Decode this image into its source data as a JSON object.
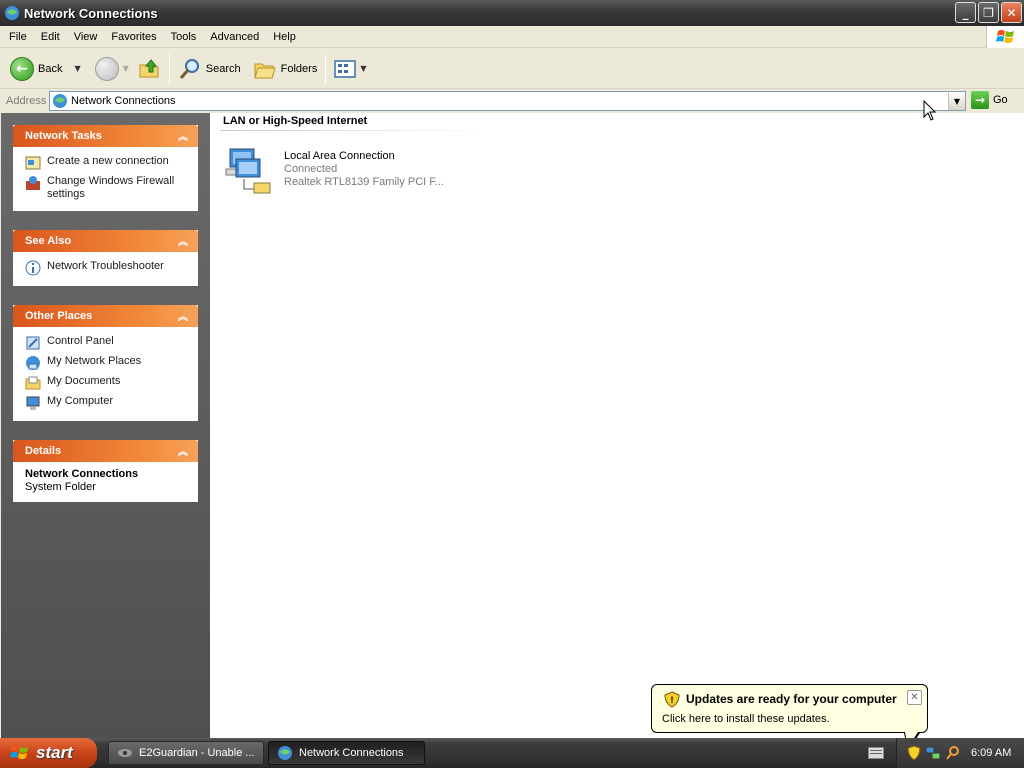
{
  "window": {
    "title": "Network Connections",
    "minimize_label": "_",
    "restore_label": "❐",
    "close_label": "✕"
  },
  "menu": [
    "File",
    "Edit",
    "View",
    "Favorites",
    "Tools",
    "Advanced",
    "Help"
  ],
  "toolbar": {
    "back_label": "Back",
    "search_label": "Search",
    "folders_label": "Folders"
  },
  "address": {
    "label": "Address",
    "value": "Network Connections",
    "go_label": "Go"
  },
  "left_pane": {
    "network_tasks": {
      "title": "Network Tasks",
      "items": [
        "Create a new connection",
        "Change Windows Firewall settings"
      ]
    },
    "see_also": {
      "title": "See Also",
      "items": [
        "Network Troubleshooter"
      ]
    },
    "other_places": {
      "title": "Other Places",
      "items": [
        "Control Panel",
        "My Network Places",
        "My Documents",
        "My Computer"
      ]
    },
    "details": {
      "title": "Details",
      "name": "Network Connections",
      "type": "System Folder"
    }
  },
  "content": {
    "group_title": "LAN or High-Speed Internet",
    "connection": {
      "name": "Local Area Connection",
      "status": "Connected",
      "adapter": "Realtek RTL8139 Family PCI F..."
    }
  },
  "balloon": {
    "title": "Updates are ready for your computer",
    "text": "Click here to install these updates."
  },
  "taskbar": {
    "start_label": "start",
    "tasks": [
      {
        "label": "E2Guardian - Unable ..."
      },
      {
        "label": "Network Connections"
      }
    ],
    "time": "6:09 AM"
  },
  "colors": {
    "panel_header": "#e9672b",
    "pane_background": "#5a5a5a",
    "address_border": "#7f9db9"
  }
}
